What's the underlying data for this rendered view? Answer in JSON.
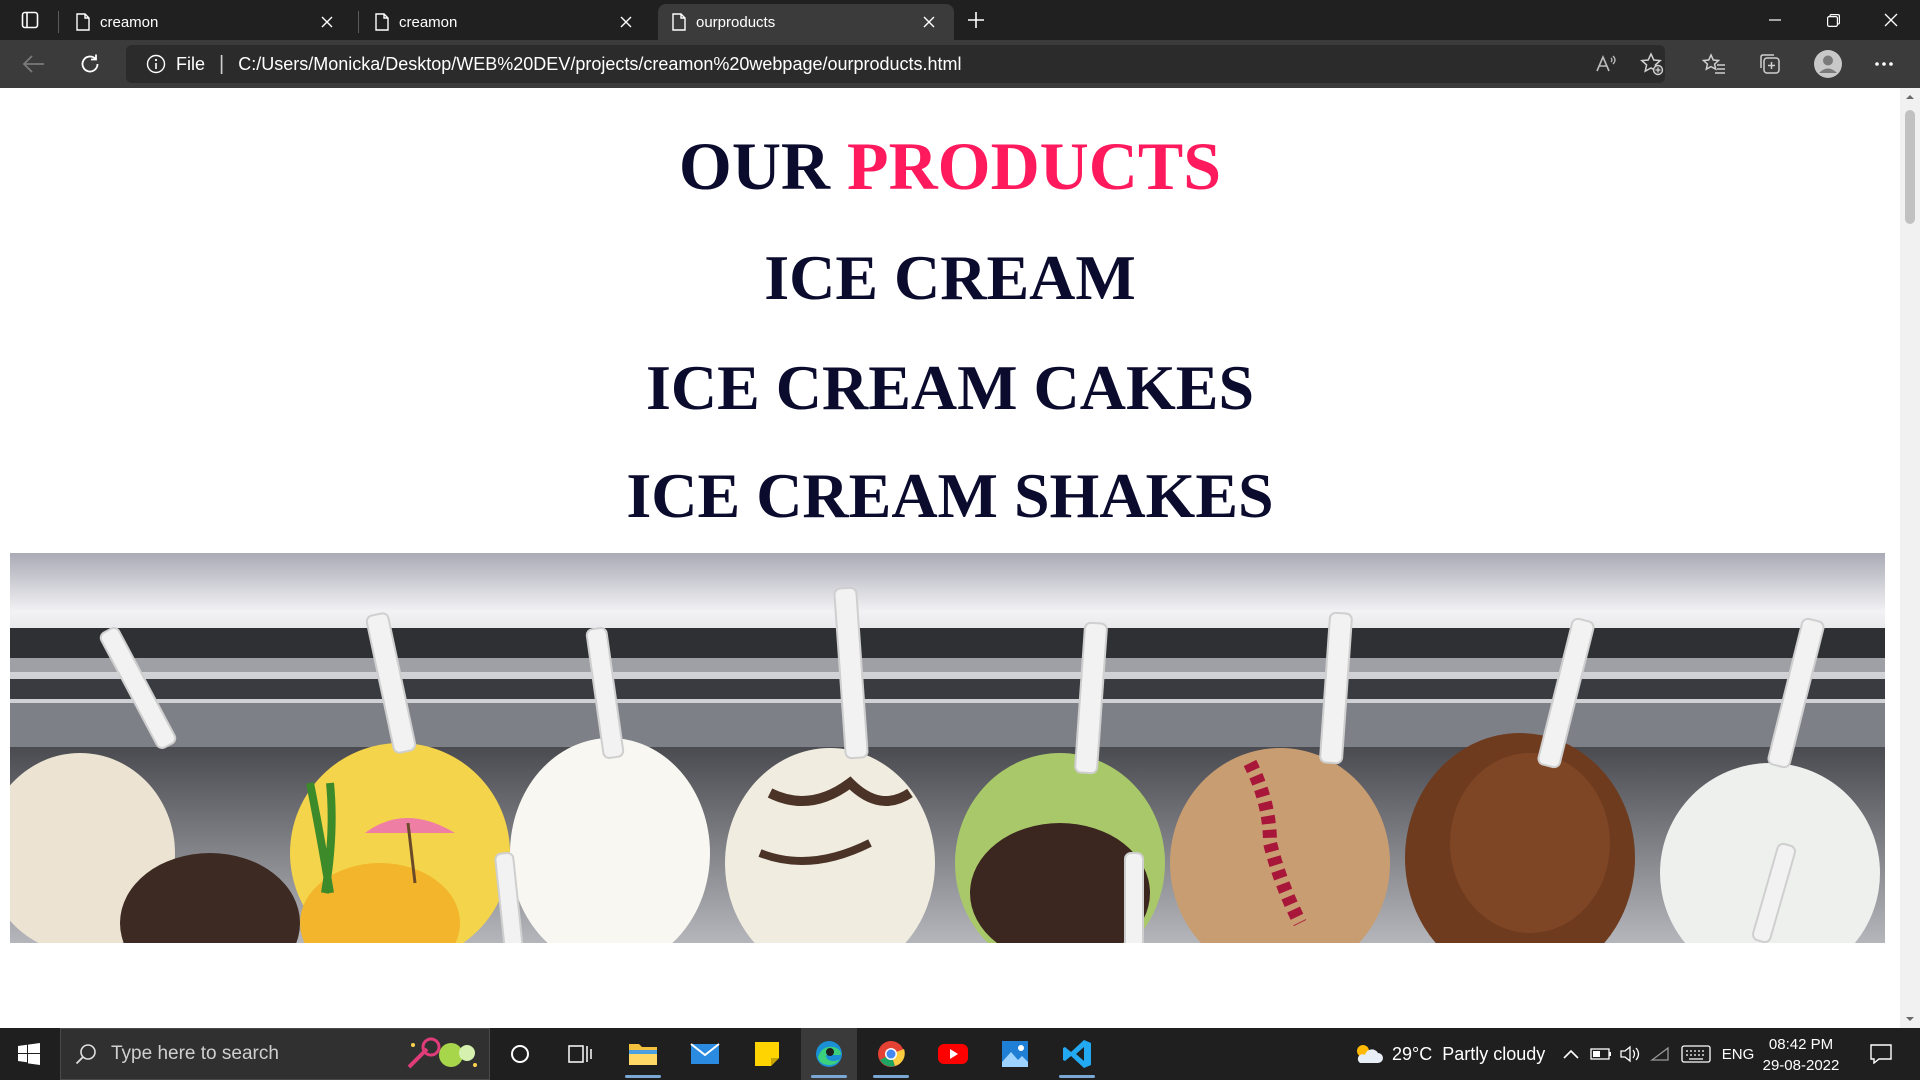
{
  "browser": {
    "tabs": [
      {
        "title": "creamon",
        "active": false
      },
      {
        "title": "creamon",
        "active": false
      },
      {
        "title": "ourproducts",
        "active": true
      }
    ],
    "address": {
      "site_label": "File",
      "url": "C:/Users/Monicka/Desktop/WEB%20DEV/projects/creamon%20webpage/ourproducts.html"
    },
    "toolbar_icons": [
      "read-aloud-icon",
      "add-favorite-icon",
      "favorites-icon",
      "collections-icon",
      "profile-icon",
      "more-icon"
    ]
  },
  "page": {
    "title_part1": "OUR ",
    "title_part2": "PRODUCTS",
    "items": [
      "ICE CREAM",
      "ICE CREAM CAKES",
      "ICE CREAM SHAKES"
    ],
    "colors": {
      "heading": "#0b0b2e",
      "accent": "#ff1a5e"
    },
    "hero_description": "gelato display"
  },
  "taskbar": {
    "search_placeholder": "Type here to search",
    "weather": "29°C  Partly cloudy",
    "language": "ENG",
    "time": "08:42 PM",
    "date": "29-08-2022",
    "apps": [
      "file-explorer",
      "mail",
      "sticky-notes",
      "edge",
      "chrome",
      "youtube",
      "photos",
      "vscode"
    ]
  }
}
